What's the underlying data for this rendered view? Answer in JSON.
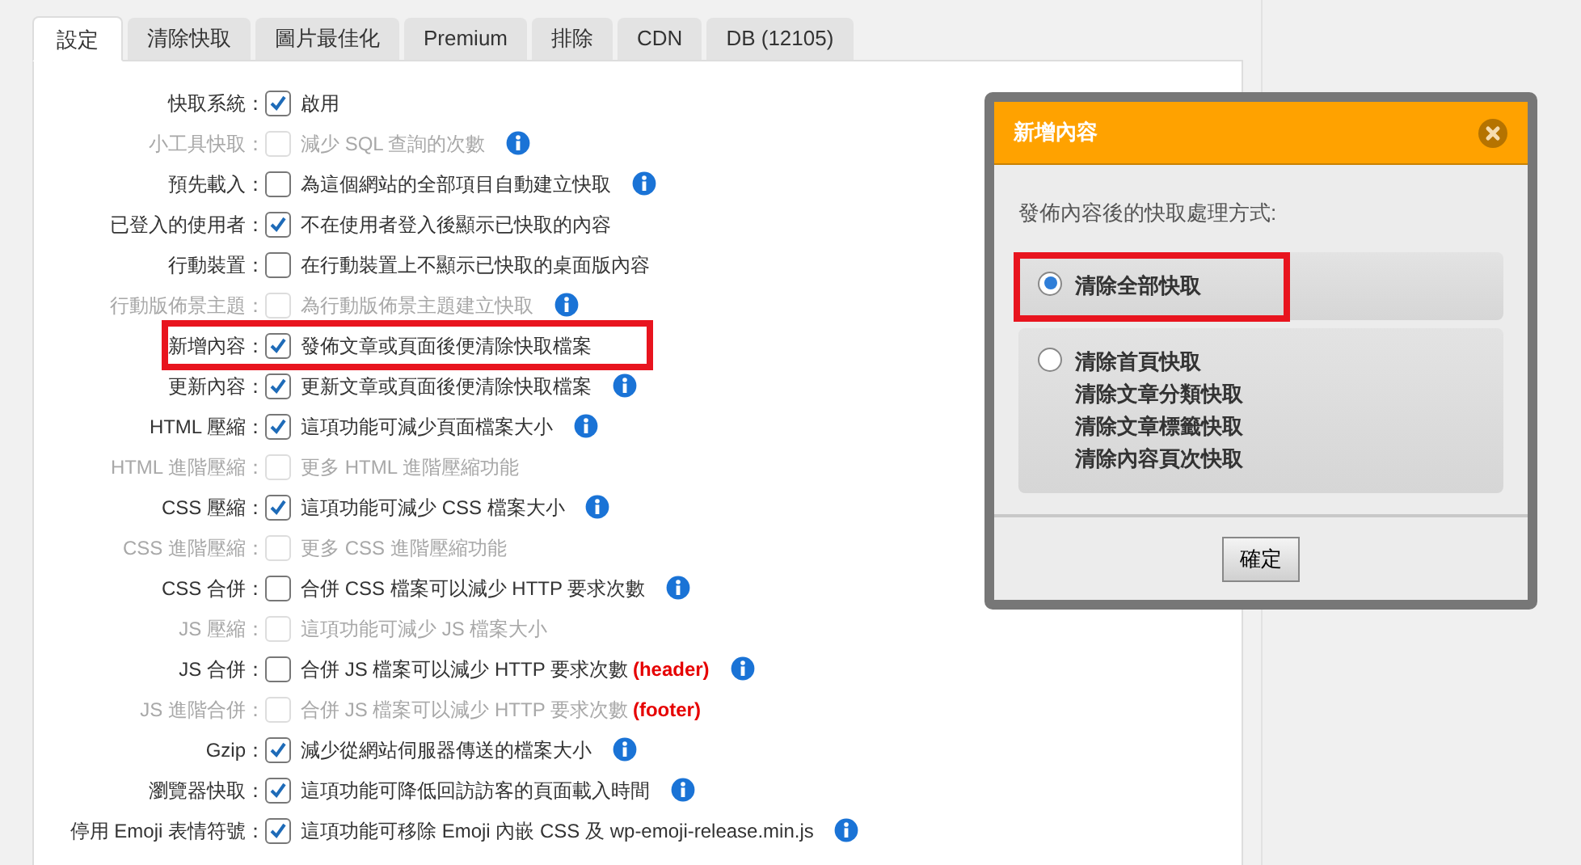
{
  "tabs": [
    {
      "label": "設定",
      "selected": true
    },
    {
      "label": "清除快取",
      "selected": false
    },
    {
      "label": "圖片最佳化",
      "selected": false
    },
    {
      "label": "Premium",
      "selected": false
    },
    {
      "label": "排除",
      "selected": false
    },
    {
      "label": "CDN",
      "selected": false
    },
    {
      "label": "DB (12105)",
      "selected": false
    }
  ],
  "settings": [
    {
      "label": "快取系統：",
      "text": "啟用",
      "checked": true,
      "disabled": false,
      "info": false,
      "highlighted": false
    },
    {
      "label": "小工具快取：",
      "text": "減少 SQL 查詢的次數",
      "checked": false,
      "disabled": true,
      "info": true,
      "highlighted": false
    },
    {
      "label": "預先載入：",
      "text": "為這個網站的全部項目自動建立快取",
      "checked": false,
      "disabled": false,
      "info": true,
      "highlighted": false
    },
    {
      "label": "已登入的使用者：",
      "text": "不在使用者登入後顯示已快取的內容",
      "checked": true,
      "disabled": false,
      "info": false,
      "highlighted": false
    },
    {
      "label": "行動裝置：",
      "text": "在行動裝置上不顯示已快取的桌面版內容",
      "checked": false,
      "disabled": false,
      "info": false,
      "highlighted": false
    },
    {
      "label": "行動版佈景主題：",
      "text": "為行動版佈景主題建立快取",
      "checked": false,
      "disabled": true,
      "info": true,
      "highlighted": false
    },
    {
      "label": "新增內容：",
      "text": "發佈文章或頁面後便清除快取檔案",
      "checked": true,
      "disabled": false,
      "info": false,
      "highlighted": true
    },
    {
      "label": "更新內容：",
      "text": "更新文章或頁面後便清除快取檔案",
      "checked": true,
      "disabled": false,
      "info": true,
      "highlighted": false
    },
    {
      "label": "HTML 壓縮：",
      "text": "這項功能可減少頁面檔案大小",
      "checked": true,
      "disabled": false,
      "info": true,
      "highlighted": false
    },
    {
      "label": "HTML 進階壓縮：",
      "text": "更多 HTML 進階壓縮功能",
      "checked": false,
      "disabled": true,
      "info": false,
      "highlighted": false
    },
    {
      "label": "CSS 壓縮：",
      "text": "這項功能可減少 CSS 檔案大小",
      "checked": true,
      "disabled": false,
      "info": true,
      "highlighted": false
    },
    {
      "label": "CSS 進階壓縮：",
      "text": "更多 CSS 進階壓縮功能",
      "checked": false,
      "disabled": true,
      "info": false,
      "highlighted": false
    },
    {
      "label": "CSS 合併：",
      "text": "合併 CSS 檔案可以減少 HTTP 要求次數",
      "checked": false,
      "disabled": false,
      "info": true,
      "highlighted": false
    },
    {
      "label": "JS 壓縮：",
      "text": "這項功能可減少 JS 檔案大小",
      "checked": false,
      "disabled": true,
      "info": false,
      "highlighted": false
    },
    {
      "label": "JS 合併：",
      "text": "合併 JS 檔案可以減少 HTTP 要求次數",
      "note": "(header)",
      "checked": false,
      "disabled": false,
      "info": true,
      "highlighted": false
    },
    {
      "label": "JS 進階合併：",
      "text": "合併 JS 檔案可以減少 HTTP 要求次數",
      "note": "(footer)",
      "checked": false,
      "disabled": true,
      "info": false,
      "highlighted": false
    },
    {
      "label": "Gzip：",
      "text": "減少從網站伺服器傳送的檔案大小",
      "checked": true,
      "disabled": false,
      "info": true,
      "highlighted": false
    },
    {
      "label": "瀏覽器快取：",
      "text": "這項功能可降低回訪訪客的頁面載入時間",
      "checked": true,
      "disabled": false,
      "info": true,
      "highlighted": false
    },
    {
      "label": "停用 Emoji 表情符號：",
      "text": "這項功能可移除 Emoji 內嵌 CSS 及 wp-emoji-release.min.js",
      "checked": true,
      "disabled": false,
      "info": true,
      "highlighted": false
    }
  ],
  "dialog": {
    "title": "新增內容",
    "prompt": "發佈內容後的快取處理方式:",
    "options": [
      {
        "lines": [
          "清除全部快取"
        ],
        "selected": true,
        "highlighted": true
      },
      {
        "lines": [
          "清除首頁快取",
          "清除文章分類快取",
          "清除文章標籤快取",
          "清除內容頁次快取"
        ],
        "selected": false,
        "highlighted": false
      }
    ],
    "button": "確定"
  }
}
